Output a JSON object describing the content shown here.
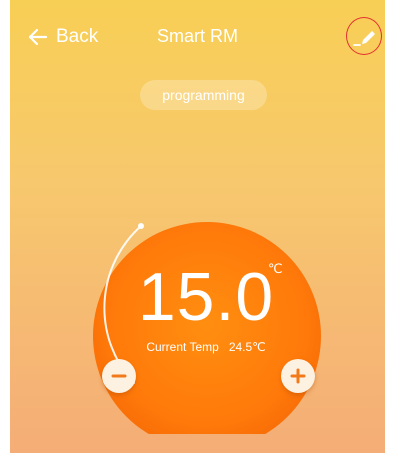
{
  "header": {
    "back_label": "Back",
    "title": "Smart RM"
  },
  "mode_pill": "programming",
  "thermostat": {
    "set_temp": "15.0",
    "unit": "℃",
    "current_label": "Current Temp",
    "current_value": "24.5℃"
  },
  "icons": {
    "back": "arrow-left-icon",
    "edit": "pencil-icon",
    "decrease": "minus-icon",
    "increase": "plus-icon"
  },
  "colors": {
    "background_top": "#f8cf55",
    "background_bottom": "#f4ad76",
    "dial_orange": "#ff7a0a",
    "highlight_circle": "#e23030",
    "button_fill": "#fdf1e2",
    "button_glyph": "#f27a1a"
  }
}
